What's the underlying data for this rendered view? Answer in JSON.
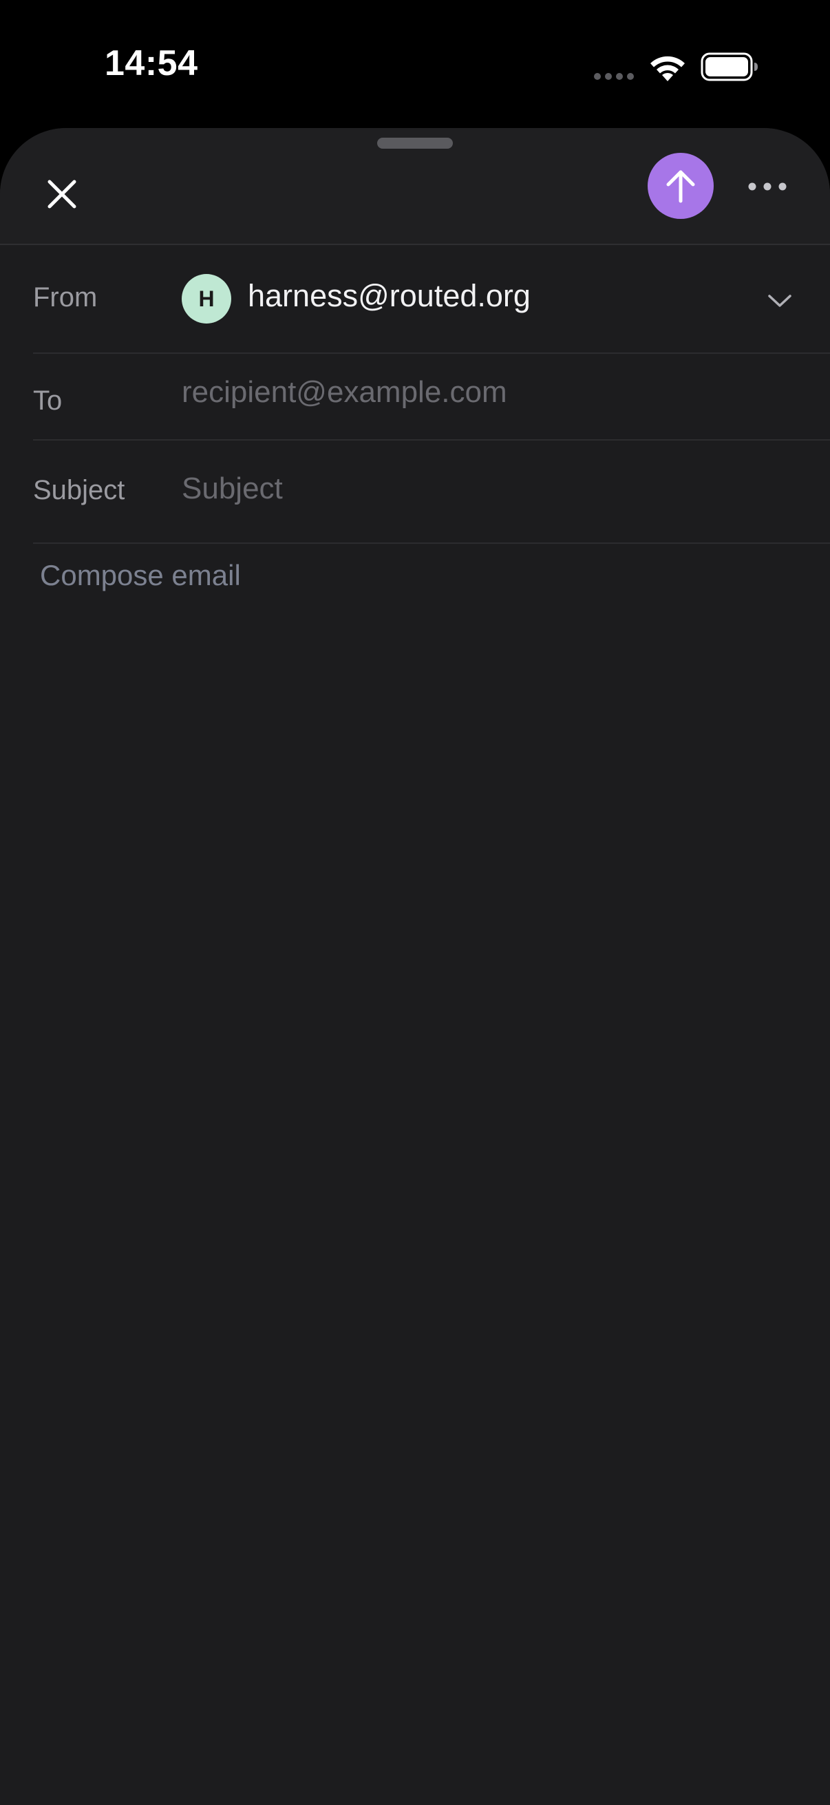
{
  "status_bar": {
    "time": "14:54",
    "icons": [
      "cellular-dots-icon",
      "wifi-icon",
      "battery-icon"
    ]
  },
  "toolbar": {
    "close_icon": "close-icon",
    "send_icon": "arrow-up-icon",
    "more_icon": "more-horizontal-icon",
    "send_color": "#a776e8"
  },
  "from": {
    "label": "From",
    "avatar_initial": "H",
    "avatar_color": "#bfe8d3",
    "value": "harness@routed.org",
    "dropdown_icon": "chevron-down-icon"
  },
  "to": {
    "label": "To",
    "value": "",
    "placeholder": "recipient@example.com"
  },
  "subject": {
    "label": "Subject",
    "value": "",
    "placeholder": "Subject"
  },
  "body": {
    "value": "",
    "placeholder": "Compose email"
  }
}
